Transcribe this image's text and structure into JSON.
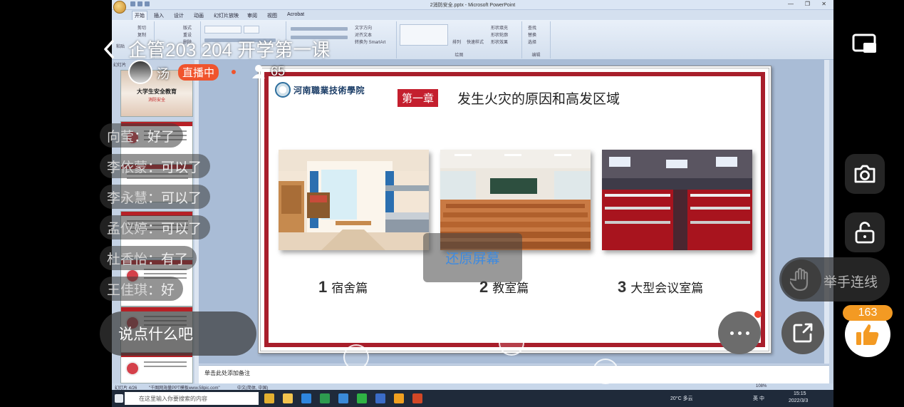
{
  "app": {
    "window_title": "2消防安全.pptx - Microsoft PowerPoint",
    "tabs": [
      "开始",
      "插入",
      "设计",
      "动画",
      "幻灯片放映",
      "审阅",
      "视图",
      "Acrobat"
    ],
    "ribbon_labels": {
      "clipboard": [
        "剪切",
        "复制",
        "粘贴"
      ],
      "slides": [
        "版式",
        "重设",
        "删除"
      ],
      "paragraph": [
        "文字方向",
        "对齐文本",
        "转换为 SmartArt"
      ],
      "drawing": [
        "排列",
        "快速样式",
        "形状填充",
        "形状轮廓",
        "形状效果"
      ],
      "group_drawing": "绘图",
      "editing": [
        "查找",
        "替换",
        "选择"
      ],
      "group_editing": "编辑"
    },
    "thumb_header": "幻灯片",
    "thumb1_title": "大学生安全教育",
    "thumb1_sub": "消防安全",
    "notes_placeholder": "单击此处添加备注",
    "status": {
      "slide_info": "幻灯片 4/26",
      "theme": "\"千图网海量PPT模板www.58pic.com\"",
      "language": "中文(简体, 中国)",
      "zoom": "108%"
    },
    "taskbar": {
      "search_placeholder": "在这里输入你要搜索的内容",
      "weather": "20°C 多云",
      "time": "15:15",
      "date": "2022/3/3",
      "ime": "英 中"
    }
  },
  "slide": {
    "school": "河南職業技術學院",
    "chapter": "第一章",
    "title": "发生火灾的原因和高发区域",
    "captions": [
      {
        "num": "1",
        "label": "宿舍篇"
      },
      {
        "num": "2",
        "label": "教室篇"
      },
      {
        "num": "3",
        "label": "大型会议室篇"
      }
    ]
  },
  "live": {
    "title": "企管203 204 开学第一课",
    "host": "汤",
    "status": "直播中",
    "viewers": "65",
    "chat": [
      {
        "name": "向莹",
        "msg": "好了"
      },
      {
        "name": "李依蒙",
        "msg": "可以了"
      },
      {
        "name": "李永慧",
        "msg": "可以了"
      },
      {
        "name": "孟仪婷",
        "msg": "可以了"
      },
      {
        "name": "杜香怡",
        "msg": "有了"
      },
      {
        "name": "王佳琪",
        "msg": "好"
      }
    ],
    "input_placeholder": "说点什么吧",
    "restore_label": "还原屏幕",
    "raise_hand_label": "举手连线",
    "likes": "163"
  },
  "colors": {
    "slide_frame": "#a81e2b",
    "chapter_bg": "#c41f2e",
    "live_badge": "#f0542d",
    "like_badge": "#f39a23",
    "restore_text": "#3d8ae0"
  },
  "icons": [
    "back-arrow-icon",
    "viewer-person-icon",
    "picture-in-picture-icon",
    "camera-icon",
    "unlock-icon",
    "raise-hand-icon",
    "more-dots-icon",
    "share-icon",
    "thumbs-up-icon"
  ]
}
